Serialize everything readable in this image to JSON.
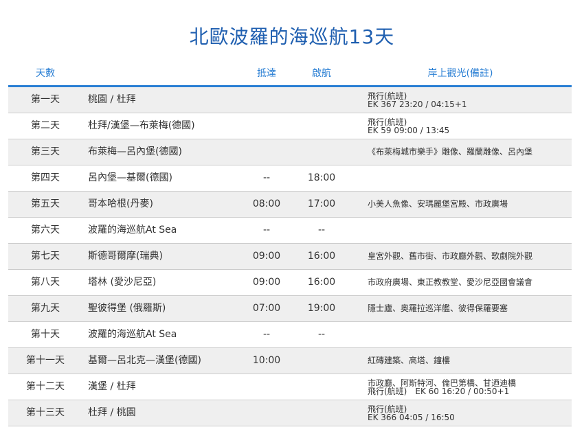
{
  "title": "北歐波羅的海巡航13天",
  "columns": {
    "day": "天數",
    "arrive": "抵達",
    "depart": "啟航",
    "tour": "岸上觀光(備註)"
  },
  "rows": [
    {
      "day": "第一天",
      "route": "桃園 / 杜拜",
      "arrive": "",
      "depart": "",
      "tour": [
        "飛行(航班)",
        "EK 367  23:20 / 04:15+1"
      ]
    },
    {
      "day": "第二天",
      "route": "杜拜/漢堡—布萊梅(德國)",
      "arrive": "",
      "depart": "",
      "tour": [
        "飛行(航班)",
        "EK 59  09:00 / 13:45"
      ]
    },
    {
      "day": "第三天",
      "route": "布萊梅—呂內堡(德國)",
      "arrive": "",
      "depart": "",
      "tour": [
        "《布萊梅城市樂手》雕像、羅蘭雕像、呂內堡"
      ]
    },
    {
      "day": "第四天",
      "route": "呂內堡—基爾(德國)",
      "arrive": "--",
      "depart": "18:00",
      "tour": []
    },
    {
      "day": "第五天",
      "route": "哥本哈根(丹麥)",
      "arrive": "08:00",
      "depart": "17:00",
      "tour": [
        "小美人魚像、安瑪麗堡宮殿、市政廣場"
      ]
    },
    {
      "day": "第六天",
      "route": "波羅的海巡航At Sea",
      "arrive": "--",
      "depart": "--",
      "tour": []
    },
    {
      "day": "第七天",
      "route": "斯德哥爾摩(瑞典)",
      "arrive": "09:00",
      "depart": "16:00",
      "tour": [
        "皇宮外觀、舊市街、市政廳外觀、歌劇院外觀"
      ]
    },
    {
      "day": "第八天",
      "route": "塔林 (愛沙尼亞)",
      "arrive": "09:00",
      "depart": "16:00",
      "tour": [
        "市政府廣場、東正教教堂、愛沙尼亞國會議會"
      ]
    },
    {
      "day": "第九天",
      "route": "聖彼得堡 (俄羅斯)",
      "arrive": "07:00",
      "depart": "19:00",
      "tour": [
        "隱士廬、奧羅拉巡洋艦、彼得保羅要塞"
      ]
    },
    {
      "day": "第十天",
      "route": "波羅的海巡航At Sea",
      "arrive": "--",
      "depart": "--",
      "tour": []
    },
    {
      "day": "第十一天",
      "route": "基爾—呂北克—漢堡(德國)",
      "arrive": "10:00",
      "depart": "",
      "tour": [
        "紅磚建築、高塔、鐘樓"
      ]
    },
    {
      "day": "第十二天",
      "route": "漢堡 / 杜拜",
      "arrive": "",
      "depart": "",
      "tour": [
        "市政廳、阿斯特河、倫巴第橋、甘迺迪橋",
        "飛行(航班)　EK 60  16:20 / 00:50+1"
      ]
    },
    {
      "day": "第十三天",
      "route": "杜拜 / 桃園",
      "arrive": "",
      "depart": "",
      "tour": [
        "飛行(航班)",
        "EK 366  04:05 / 16:50"
      ]
    }
  ]
}
